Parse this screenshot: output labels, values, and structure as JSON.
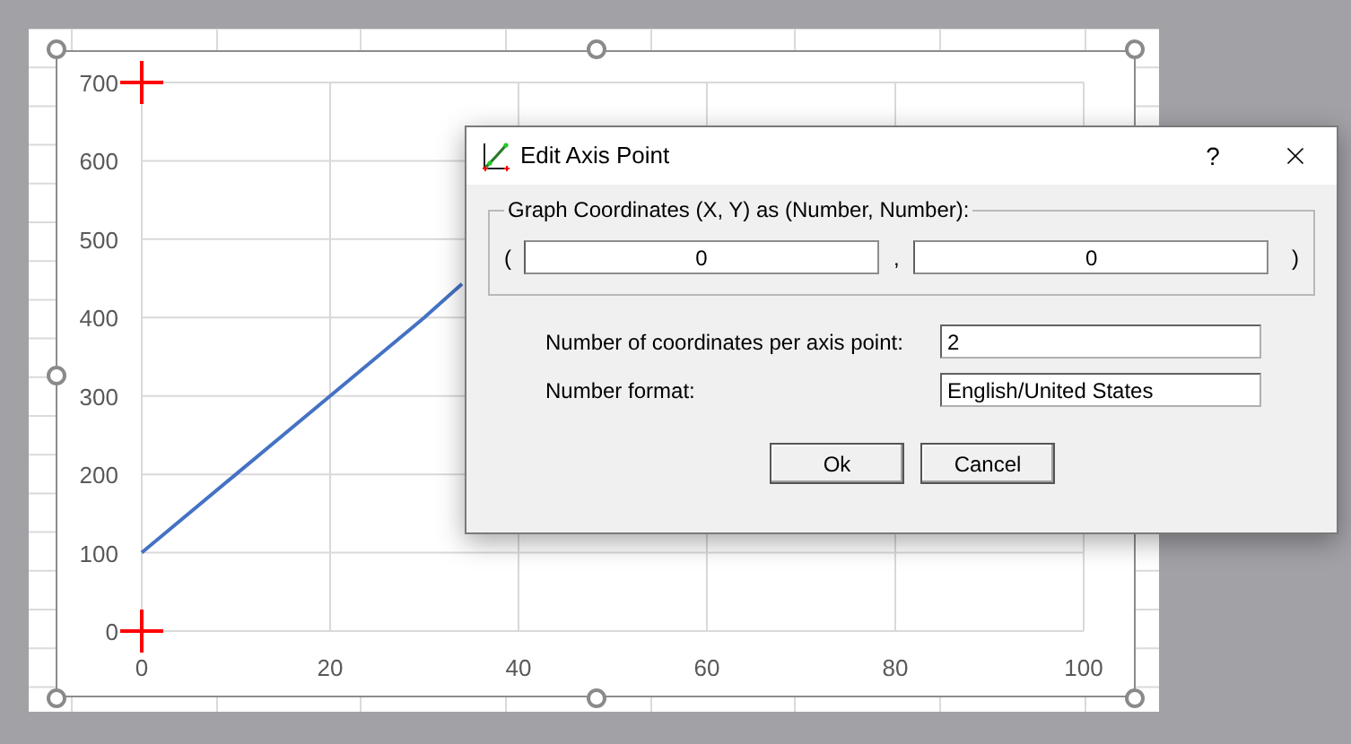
{
  "chart": {
    "chart_data": {
      "type": "line",
      "grid": true,
      "x": [
        0,
        10,
        20,
        30,
        34
      ],
      "series": [
        {
          "color": "#4472c4",
          "values": [
            100,
            200,
            300,
            400,
            443
          ]
        }
      ],
      "xlim": [
        0,
        100
      ],
      "ylim": [
        0,
        700
      ],
      "xticks": [
        0,
        20,
        40,
        60,
        80,
        100
      ],
      "yticks": [
        0,
        100,
        200,
        300,
        400,
        500,
        600,
        700
      ]
    }
  },
  "dialog": {
    "title": "Edit Axis Point",
    "help_button": "?",
    "group": {
      "label": "Graph Coordinates (X, Y) as (Number, Number):",
      "open_paren": "(",
      "x_value": "0",
      "separator": ",",
      "y_value": "0",
      "close_paren": ")"
    },
    "fields": [
      {
        "label": "Number of coordinates per axis point:",
        "value": "2"
      },
      {
        "label": "Number format:",
        "value": "English/United States"
      }
    ],
    "buttons": [
      "Ok",
      "Cancel"
    ]
  }
}
